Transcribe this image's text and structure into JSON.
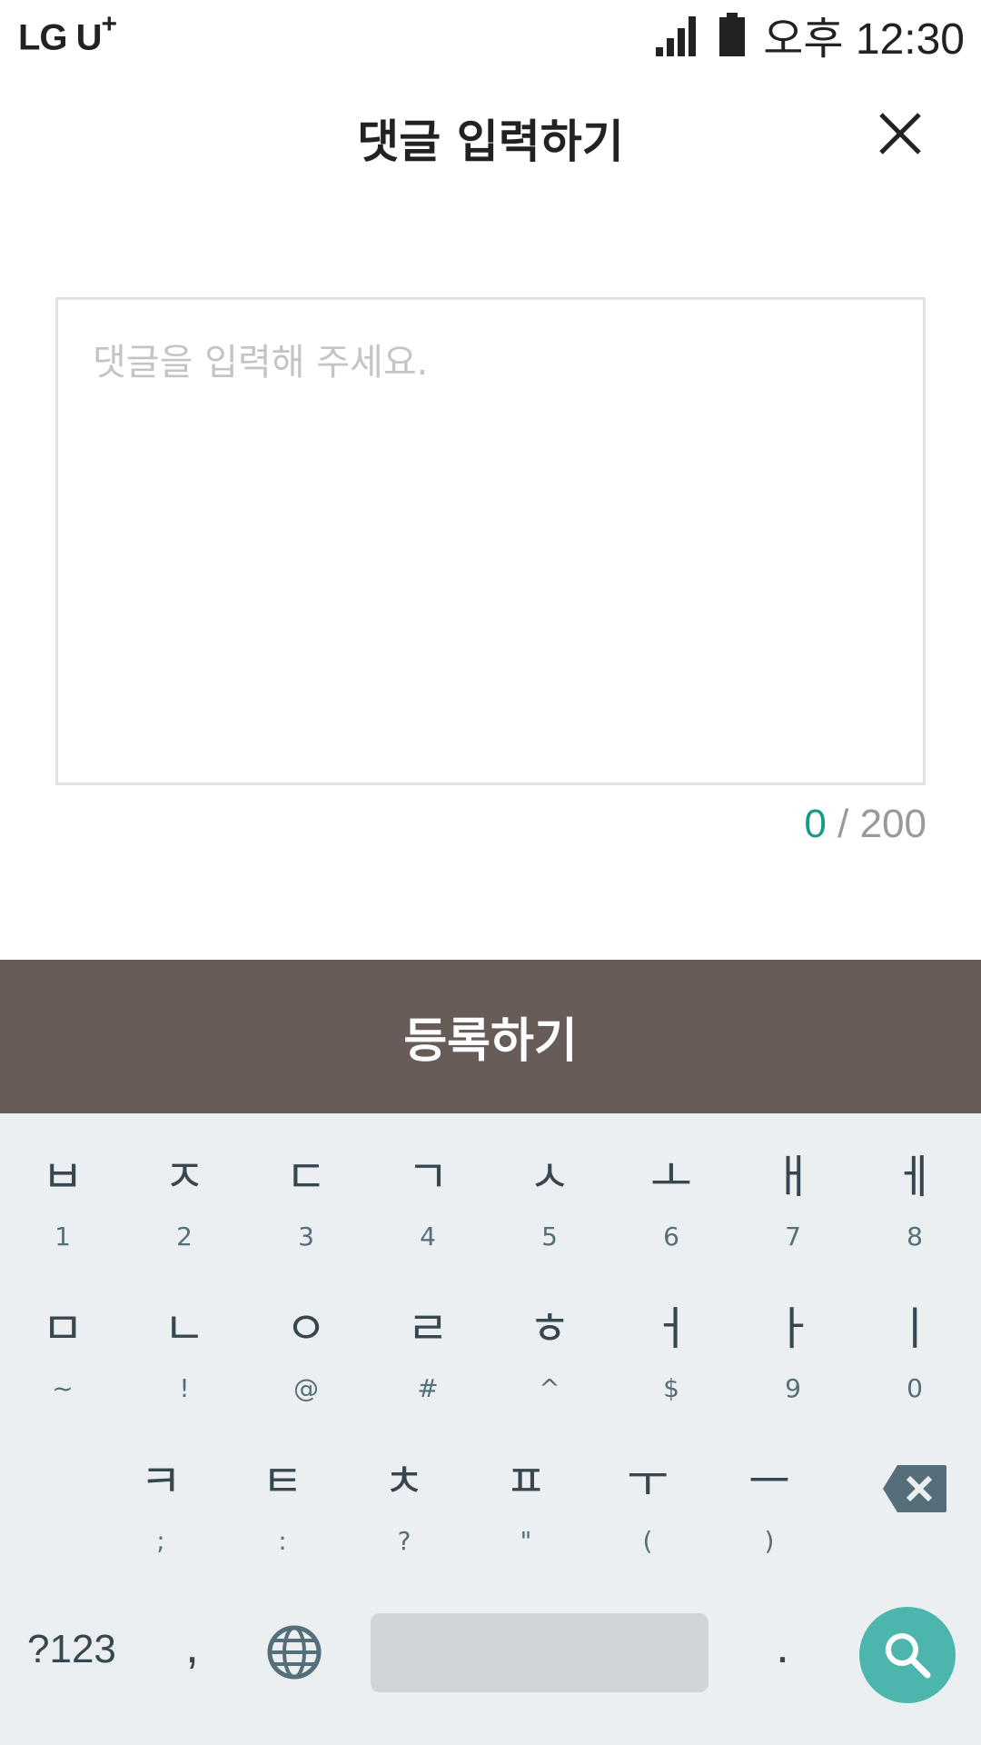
{
  "status_bar": {
    "carrier": "LG U",
    "carrier_plus": "+",
    "time": "오후 12:30",
    "icons": [
      "signal-icon",
      "battery-icon"
    ]
  },
  "header": {
    "title": "댓글 입력하기",
    "close_icon": "close-icon"
  },
  "comment": {
    "placeholder": "댓글을 입력해 주세요.",
    "value": "",
    "count": "0",
    "max_label": "/ 200"
  },
  "submit_label": "등록하기",
  "colors": {
    "accent": "#19998a",
    "submit_bg": "#675c57",
    "keyboard_bg": "#eceff2",
    "search_key": "#4db6ac"
  },
  "keyboard": {
    "row1": [
      {
        "main": "ㅂ",
        "sub": "1"
      },
      {
        "main": "ㅈ",
        "sub": "2"
      },
      {
        "main": "ㄷ",
        "sub": "3"
      },
      {
        "main": "ㄱ",
        "sub": "4"
      },
      {
        "main": "ㅅ",
        "sub": "5"
      },
      {
        "main": "ㅗ",
        "sub": "6"
      },
      {
        "main": "ㅐ",
        "sub": "7"
      },
      {
        "main": "ㅔ",
        "sub": "8"
      }
    ],
    "row2": [
      {
        "main": "ㅁ",
        "sub": "~"
      },
      {
        "main": "ㄴ",
        "sub": "!"
      },
      {
        "main": "ㅇ",
        "sub": "@"
      },
      {
        "main": "ㄹ",
        "sub": "#"
      },
      {
        "main": "ㅎ",
        "sub": "^"
      },
      {
        "main": "ㅓ",
        "sub": "$"
      },
      {
        "main": "ㅏ",
        "sub": "9"
      },
      {
        "main": "ㅣ",
        "sub": "0"
      }
    ],
    "row3": [
      {
        "main": "ㅋ",
        "sub": ";"
      },
      {
        "main": "ㅌ",
        "sub": ":"
      },
      {
        "main": "ㅊ",
        "sub": "?"
      },
      {
        "main": "ㅍ",
        "sub": "\""
      },
      {
        "main": "ㅜ",
        "sub": "("
      },
      {
        "main": "ㅡ",
        "sub": ")"
      }
    ],
    "symbols_key": "?123",
    "comma_key": ",",
    "period_key": ".",
    "icons": [
      "backspace-icon",
      "globe-icon",
      "search-icon"
    ]
  }
}
